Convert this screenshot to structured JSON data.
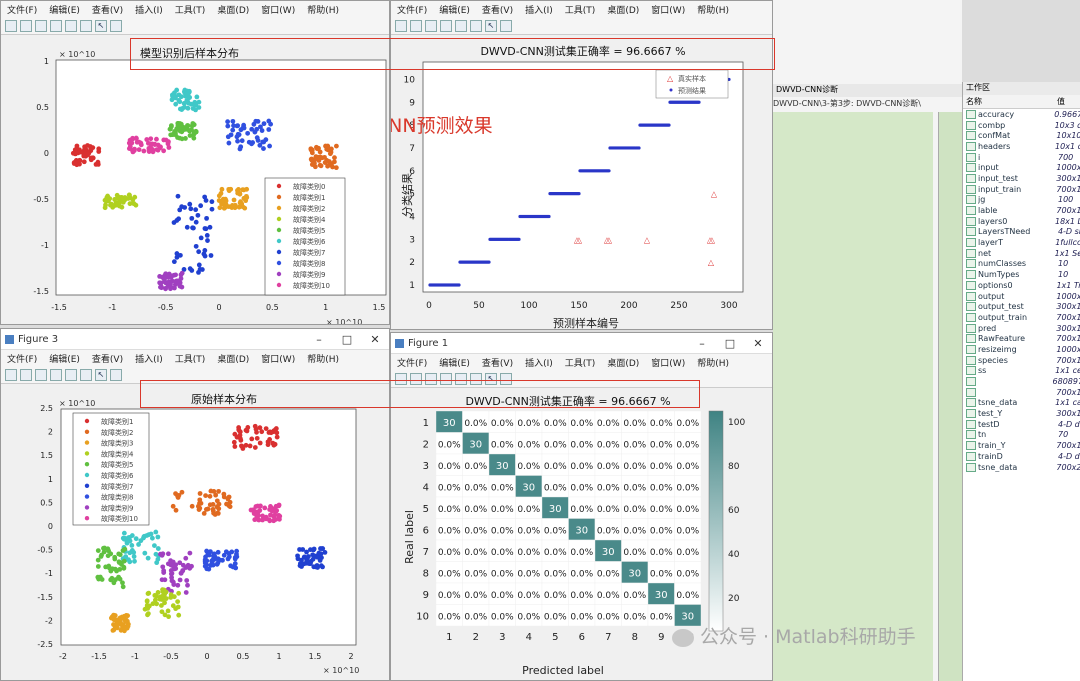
{
  "menu": [
    "文件(F)",
    "编辑(E)",
    "查看(V)",
    "插入(I)",
    "工具(T)",
    "桌面(D)",
    "窗口(W)",
    "帮助(H)"
  ],
  "win_tl": {
    "title": "模型识别后样本分布",
    "x_exp": "× 10^10",
    "y_exp": "× 10^10",
    "xticks": [
      "-1.5",
      "-1",
      "-0.5",
      "0",
      "0.5",
      "1",
      "1.5"
    ],
    "yticks": [
      "1",
      "0.5",
      "0",
      "-0.5",
      "-1",
      "-1.5"
    ],
    "legend": [
      "故障类别0",
      "故障类别1",
      "故障类别2",
      "故障类别4",
      "故障类别5",
      "故障类别6",
      "故障类别7",
      "故障类别8",
      "故障类别9",
      "故障类别10"
    ]
  },
  "win_tr": {
    "title": "DWVD-CNN测试集正确率 = 96.6667 %",
    "overlay": "第三步：DWVD-CNN预测效果",
    "xlabel": "预测样本编号",
    "ylabel": "分类结果",
    "xticks": [
      "0",
      "50",
      "100",
      "150",
      "200",
      "250",
      "300"
    ],
    "yticks": [
      "1",
      "2",
      "3",
      "4",
      "5",
      "6",
      "7",
      "8",
      "9",
      "10"
    ],
    "legend": [
      "真实样本",
      "预测结果"
    ]
  },
  "win_bl": {
    "window_title": "Figure 3",
    "title": "原始样本分布",
    "x_exp": "× 10^10",
    "y_exp": "× 10^10",
    "xticks": [
      "-2",
      "-1.5",
      "-1",
      "-0.5",
      "0",
      "0.5",
      "1",
      "1.5",
      "2"
    ],
    "yticks": [
      "2.5",
      "2",
      "1.5",
      "1",
      "0.5",
      "0",
      "-0.5",
      "-1",
      "-1.5",
      "-2",
      "-2.5"
    ],
    "legend": [
      "故障类别1",
      "故障类别2",
      "故障类别3",
      "故障类别4",
      "故障类别5",
      "故障类别6",
      "故障类别7",
      "故障类别8",
      "故障类别9",
      "故障类别10"
    ]
  },
  "win_br": {
    "window_title": "Figure 1",
    "title": "DWVD-CNN测试集正确率 = 96.6667 %",
    "xlabel": "Predicted label",
    "ylabel": "Real label",
    "labels": [
      "1",
      "2",
      "3",
      "4",
      "5",
      "6",
      "7",
      "8",
      "9",
      "10"
    ],
    "colorbar_ticks": [
      "100",
      "80",
      "60",
      "40",
      "20"
    ],
    "diag_values": [
      "30",
      "30",
      "30",
      "30",
      "30",
      "30",
      "30",
      "30",
      "30",
      "30"
    ],
    "off_label": "0.0%"
  },
  "editor": {
    "title": "DWVD-CNN诊断",
    "path": "DWVD-CNN\\3-第3步: DWVD-CNN诊断\\"
  },
  "workspace": {
    "header": "工作区",
    "col_name": "名称",
    "col_value": "值",
    "rows": [
      [
        "accuracy",
        "0.9667"
      ],
      [
        "combp",
        "10x3 d"
      ],
      [
        "confMat",
        "10x10"
      ],
      [
        "headers",
        "10x1 c"
      ],
      [
        "i",
        "700"
      ],
      [
        "input",
        "1000x"
      ],
      [
        "input_test",
        "300x1"
      ],
      [
        "input_train",
        "700x1"
      ],
      [
        "jg",
        "100"
      ],
      [
        "lable",
        "700x1"
      ],
      [
        "layers0",
        "18x1 L"
      ],
      [
        "LayersTNeed",
        "4-D si"
      ],
      [
        "layerT",
        "1fullco"
      ],
      [
        "net",
        "1x1 Se"
      ],
      [
        "numClasses",
        "10"
      ],
      [
        "NumTypes",
        "10"
      ],
      [
        "options0",
        "1x1 Tr"
      ],
      [
        "output",
        "1000x"
      ],
      [
        "output_test",
        "300x1"
      ],
      [
        "output_train",
        "700x1"
      ],
      [
        "pred",
        "300x1"
      ],
      [
        "RawFeature",
        "700x1"
      ],
      [
        "resizeimg",
        "1000x"
      ],
      [
        "species",
        "700x1"
      ],
      [
        "ss",
        "1x1 ce"
      ],
      [
        "",
        "680897"
      ],
      [
        "",
        "700x1"
      ],
      [
        "tsne_data",
        "1x1 ca"
      ],
      [
        "test_Y",
        "300x1"
      ],
      [
        "testD",
        "4-D d"
      ],
      [
        "tn",
        "70"
      ],
      [
        "train_Y",
        "700x1"
      ],
      [
        "trainD",
        "4-D d"
      ],
      [
        "tsne_data",
        "700x2"
      ]
    ]
  },
  "watermark": "公众号 · Matlab科研助手",
  "colors": {
    "highlight": "#d9382b",
    "accent": "#4a8a8a",
    "editor_bg": "#d5e8c8"
  }
}
